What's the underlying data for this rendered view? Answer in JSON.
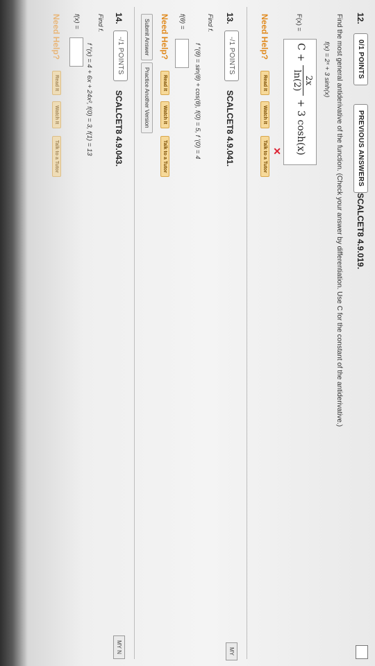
{
  "q12": {
    "number": "12.",
    "points": "0/1 POINTS",
    "previous": "PREVIOUS ANSWERS",
    "code": "SCALCET8 4.9.019.",
    "instructions": "Find the most general antiderivative of the function. (Check your answer by differentiation. Use C for the constant of the antiderivative.)",
    "function": "f(x) = 2ˣ + 3 sinh(x)",
    "answer_label": "F(x) =",
    "answer_C": "C +",
    "answer_num": "2x",
    "answer_den": "ln(2)",
    "answer_rest": "+ 3 cosh(x)",
    "wrong_mark": "✕",
    "need_help": "Need Help?",
    "read_it": "Read It",
    "watch_it": "Watch It",
    "talk_tutor": "Talk to a Tutor"
  },
  "q13": {
    "number": "13.",
    "points": "-/1 POINTS",
    "code": "SCALCET8 4.9.041.",
    "find": "Find f.",
    "equation": "f ″(θ) = sin(θ) + cos(θ),   f(0) = 5,   f ′(0) = 4",
    "answer_label": "f(θ) =",
    "need_help": "Need Help?",
    "read_it": "Read It",
    "watch_it": "Watch It",
    "talk_tutor": "Talk to a Tutor",
    "submit": "Submit Answer",
    "practice": "Practice Another Version"
  },
  "q14": {
    "number": "14.",
    "points": "-/1 POINTS",
    "code": "SCALCET8 4.9.043.",
    "find": "Find f.",
    "equation": "f ″(x) = 4 + 6x + 24x²,   f(0) = 3,   f(1) = 13",
    "answer_label": "f(x) =",
    "need_help": "Need Help?",
    "read_it": "Read It",
    "watch_it": "Watch It",
    "talk_tutor": "Talk to a Tutor"
  },
  "right_tabs": {
    "my1": "MY",
    "my2": "MY N"
  }
}
